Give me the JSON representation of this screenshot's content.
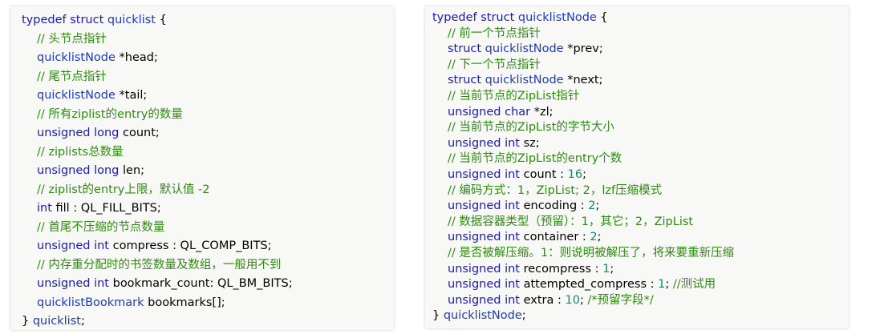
{
  "left": {
    "lines": [
      {
        "indent": false,
        "parts": [
          {
            "k": "kw",
            "t": "typedef struct "
          },
          {
            "k": "ty",
            "t": "quicklist"
          },
          {
            "k": "tx",
            "t": " {"
          }
        ]
      },
      {
        "indent": true,
        "parts": [
          {
            "k": "cm",
            "t": "// 头节点指针"
          }
        ]
      },
      {
        "indent": true,
        "parts": [
          {
            "k": "ty",
            "t": "quicklistNode"
          },
          {
            "k": "tx",
            "t": " *head;"
          }
        ]
      },
      {
        "indent": true,
        "parts": [
          {
            "k": "cm",
            "t": "// 尾节点指针"
          }
        ]
      },
      {
        "indent": true,
        "parts": [
          {
            "k": "ty",
            "t": "quicklistNode"
          },
          {
            "k": "tx",
            "t": " *tail;"
          }
        ]
      },
      {
        "indent": true,
        "parts": [
          {
            "k": "cm",
            "t": "// 所有ziplist的entry的数量"
          }
        ]
      },
      {
        "indent": true,
        "parts": [
          {
            "k": "kw",
            "t": "unsigned long"
          },
          {
            "k": "tx",
            "t": " count;"
          }
        ]
      },
      {
        "indent": true,
        "parts": [
          {
            "k": "cm",
            "t": "// ziplists总数量"
          }
        ]
      },
      {
        "indent": true,
        "parts": [
          {
            "k": "kw",
            "t": "unsigned long"
          },
          {
            "k": "tx",
            "t": " len;"
          }
        ]
      },
      {
        "indent": true,
        "parts": [
          {
            "k": "cm",
            "t": "// ziplist的entry上限，默认值 -2"
          }
        ]
      },
      {
        "indent": true,
        "parts": [
          {
            "k": "kw",
            "t": "int"
          },
          {
            "k": "tx",
            "t": " fill : QL_FILL_BITS;"
          }
        ]
      },
      {
        "indent": true,
        "parts": [
          {
            "k": "cm",
            "t": "// 首尾不压缩的节点数量"
          }
        ]
      },
      {
        "indent": true,
        "parts": [
          {
            "k": "kw",
            "t": "unsigned int"
          },
          {
            "k": "tx",
            "t": " compress : QL_COMP_BITS;"
          }
        ]
      },
      {
        "indent": true,
        "parts": [
          {
            "k": "cm",
            "t": "// 内存重分配时的书签数量及数组，一般用不到"
          }
        ]
      },
      {
        "indent": true,
        "parts": [
          {
            "k": "kw",
            "t": "unsigned int"
          },
          {
            "k": "tx",
            "t": " bookmark_count: QL_BM_BITS;"
          }
        ]
      },
      {
        "indent": true,
        "parts": [
          {
            "k": "ty",
            "t": "quicklistBookmark"
          },
          {
            "k": "tx",
            "t": " bookmarks[];"
          }
        ]
      },
      {
        "indent": false,
        "parts": [
          {
            "k": "tx",
            "t": "} "
          },
          {
            "k": "ty",
            "t": "quicklist"
          },
          {
            "k": "tx",
            "t": ";"
          }
        ]
      }
    ]
  },
  "right": {
    "lines": [
      {
        "indent": false,
        "parts": [
          {
            "k": "kw",
            "t": "typedef struct "
          },
          {
            "k": "ty",
            "t": "quicklistNode"
          },
          {
            "k": "tx",
            "t": " {"
          }
        ]
      },
      {
        "indent": true,
        "parts": [
          {
            "k": "cm",
            "t": "// 前一个节点指针"
          }
        ]
      },
      {
        "indent": true,
        "parts": [
          {
            "k": "kw",
            "t": "struct "
          },
          {
            "k": "ty",
            "t": "quicklistNode"
          },
          {
            "k": "tx",
            "t": " *prev;"
          }
        ]
      },
      {
        "indent": true,
        "parts": [
          {
            "k": "cm",
            "t": "// 下一个节点指针"
          }
        ]
      },
      {
        "indent": true,
        "parts": [
          {
            "k": "kw",
            "t": "struct "
          },
          {
            "k": "ty",
            "t": "quicklistNode"
          },
          {
            "k": "tx",
            "t": " *next;"
          }
        ]
      },
      {
        "indent": true,
        "parts": [
          {
            "k": "cm",
            "t": "// 当前节点的ZipList指针"
          }
        ]
      },
      {
        "indent": true,
        "parts": [
          {
            "k": "kw",
            "t": "unsigned char"
          },
          {
            "k": "tx",
            "t": " *zl;"
          }
        ]
      },
      {
        "indent": true,
        "parts": [
          {
            "k": "cm",
            "t": "// 当前节点的ZipList的字节大小"
          }
        ]
      },
      {
        "indent": true,
        "parts": [
          {
            "k": "kw",
            "t": "unsigned int"
          },
          {
            "k": "tx",
            "t": " sz;"
          }
        ]
      },
      {
        "indent": true,
        "parts": [
          {
            "k": "cm",
            "t": "// 当前节点的ZipList的entry个数"
          }
        ]
      },
      {
        "indent": true,
        "parts": [
          {
            "k": "kw",
            "t": "unsigned int"
          },
          {
            "k": "tx",
            "t": " count : "
          },
          {
            "k": "nm",
            "t": "16"
          },
          {
            "k": "tx",
            "t": ";"
          }
        ]
      },
      {
        "indent": true,
        "parts": [
          {
            "k": "cm",
            "t": "// 编码方式：1，ZipList; 2，lzf压缩模式"
          }
        ]
      },
      {
        "indent": true,
        "parts": [
          {
            "k": "kw",
            "t": "unsigned int"
          },
          {
            "k": "tx",
            "t": " encoding : "
          },
          {
            "k": "nm",
            "t": "2"
          },
          {
            "k": "tx",
            "t": ";"
          }
        ]
      },
      {
        "indent": true,
        "parts": [
          {
            "k": "cm",
            "t": "// 数据容器类型（预留）：1，其它；2，ZipList"
          }
        ]
      },
      {
        "indent": true,
        "parts": [
          {
            "k": "kw",
            "t": "unsigned int"
          },
          {
            "k": "tx",
            "t": " container : "
          },
          {
            "k": "nm",
            "t": "2"
          },
          {
            "k": "tx",
            "t": ";"
          }
        ]
      },
      {
        "indent": true,
        "parts": [
          {
            "k": "cm",
            "t": "// 是否被解压缩。1：则说明被解压了，将来要重新压缩"
          }
        ]
      },
      {
        "indent": true,
        "parts": [
          {
            "k": "kw",
            "t": "unsigned int"
          },
          {
            "k": "tx",
            "t": " recompress : "
          },
          {
            "k": "nm",
            "t": "1"
          },
          {
            "k": "tx",
            "t": ";"
          }
        ]
      },
      {
        "indent": true,
        "parts": [
          {
            "k": "kw",
            "t": "unsigned int"
          },
          {
            "k": "tx",
            "t": " attempted_compress : "
          },
          {
            "k": "nm",
            "t": "1"
          },
          {
            "k": "tx",
            "t": "; "
          },
          {
            "k": "cm",
            "t": "//测试用"
          }
        ]
      },
      {
        "indent": true,
        "parts": [
          {
            "k": "kw",
            "t": "unsigned int"
          },
          {
            "k": "tx",
            "t": " extra : "
          },
          {
            "k": "nm",
            "t": "10"
          },
          {
            "k": "tx",
            "t": "; "
          },
          {
            "k": "cm",
            "t": "/*预留字段*/"
          }
        ]
      },
      {
        "indent": false,
        "parts": [
          {
            "k": "tx",
            "t": "} "
          },
          {
            "k": "ty",
            "t": "quicklistNode"
          },
          {
            "k": "tx",
            "t": ";"
          }
        ]
      }
    ]
  }
}
